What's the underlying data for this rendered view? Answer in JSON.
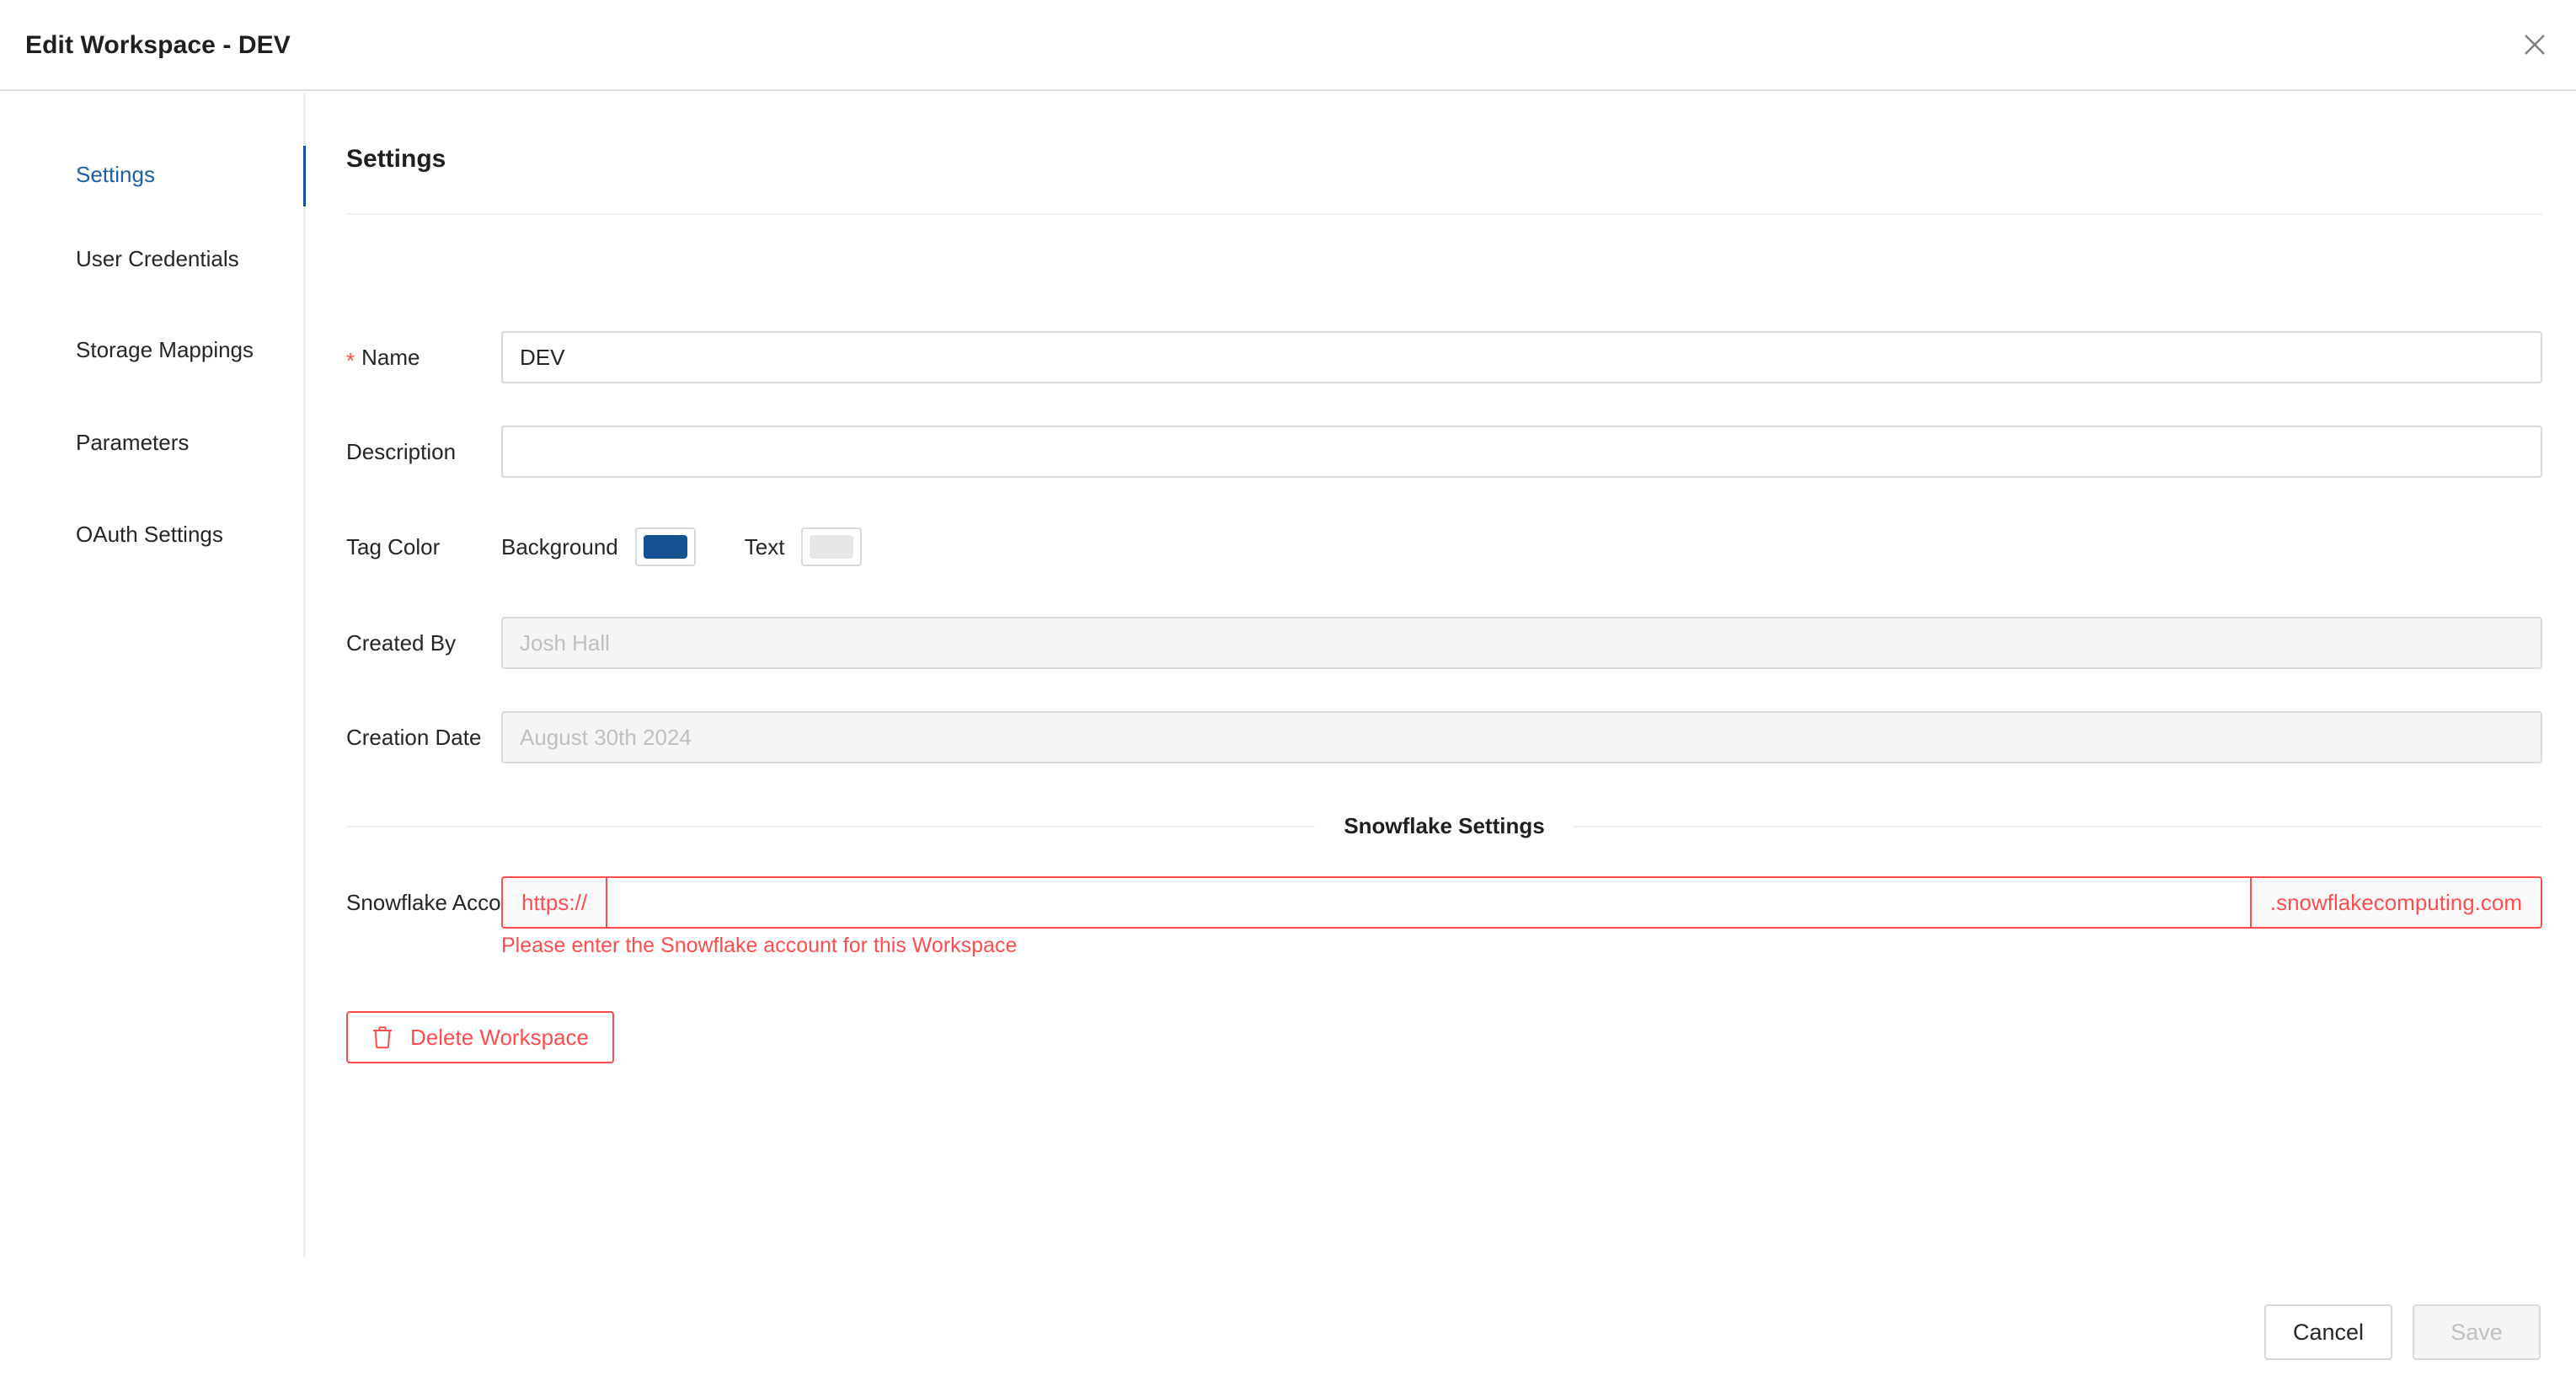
{
  "header": {
    "title": "Edit Workspace - DEV",
    "close_icon": "close-icon"
  },
  "sidebar": {
    "items": [
      {
        "label": "Settings",
        "active": true
      },
      {
        "label": "User Credentials",
        "active": false
      },
      {
        "label": "Storage Mappings",
        "active": false
      },
      {
        "label": "Parameters",
        "active": false
      },
      {
        "label": "OAuth Settings",
        "active": false
      }
    ]
  },
  "main": {
    "section_title": "Settings",
    "fields": {
      "name": {
        "label": "Name",
        "required_marker": "*",
        "value": "DEV",
        "placeholder": ""
      },
      "description": {
        "label": "Description",
        "value": "",
        "placeholder": ""
      },
      "tag_color": {
        "label": "Tag Color",
        "background_label": "Background",
        "background_color": "#155190",
        "text_label": "Text",
        "text_color": "#e6e7e8"
      },
      "created_by": {
        "label": "Created By",
        "value": "Josh Hall",
        "disabled": true
      },
      "creation_date": {
        "label": "Creation Date",
        "value": "August 30th 2024",
        "disabled": true
      }
    },
    "snowflake_section": {
      "divider_label": "Snowflake Settings",
      "account": {
        "label": "Snowflake Account",
        "prefix": "https://",
        "value": "",
        "placeholder": "",
        "suffix": ".snowflakecomputing.com",
        "error_message": "Please enter the Snowflake account for this Workspace",
        "error_color": "#ff4d4f"
      }
    },
    "delete_button": {
      "label": "Delete Workspace",
      "icon": "trash-icon"
    }
  },
  "footer": {
    "cancel_label": "Cancel",
    "save_label": "Save",
    "save_disabled": true
  },
  "colors": {
    "accent": "#155196",
    "danger": "#ff4d4f",
    "border": "#d9d9d9",
    "divider": "#f0f0f0"
  }
}
